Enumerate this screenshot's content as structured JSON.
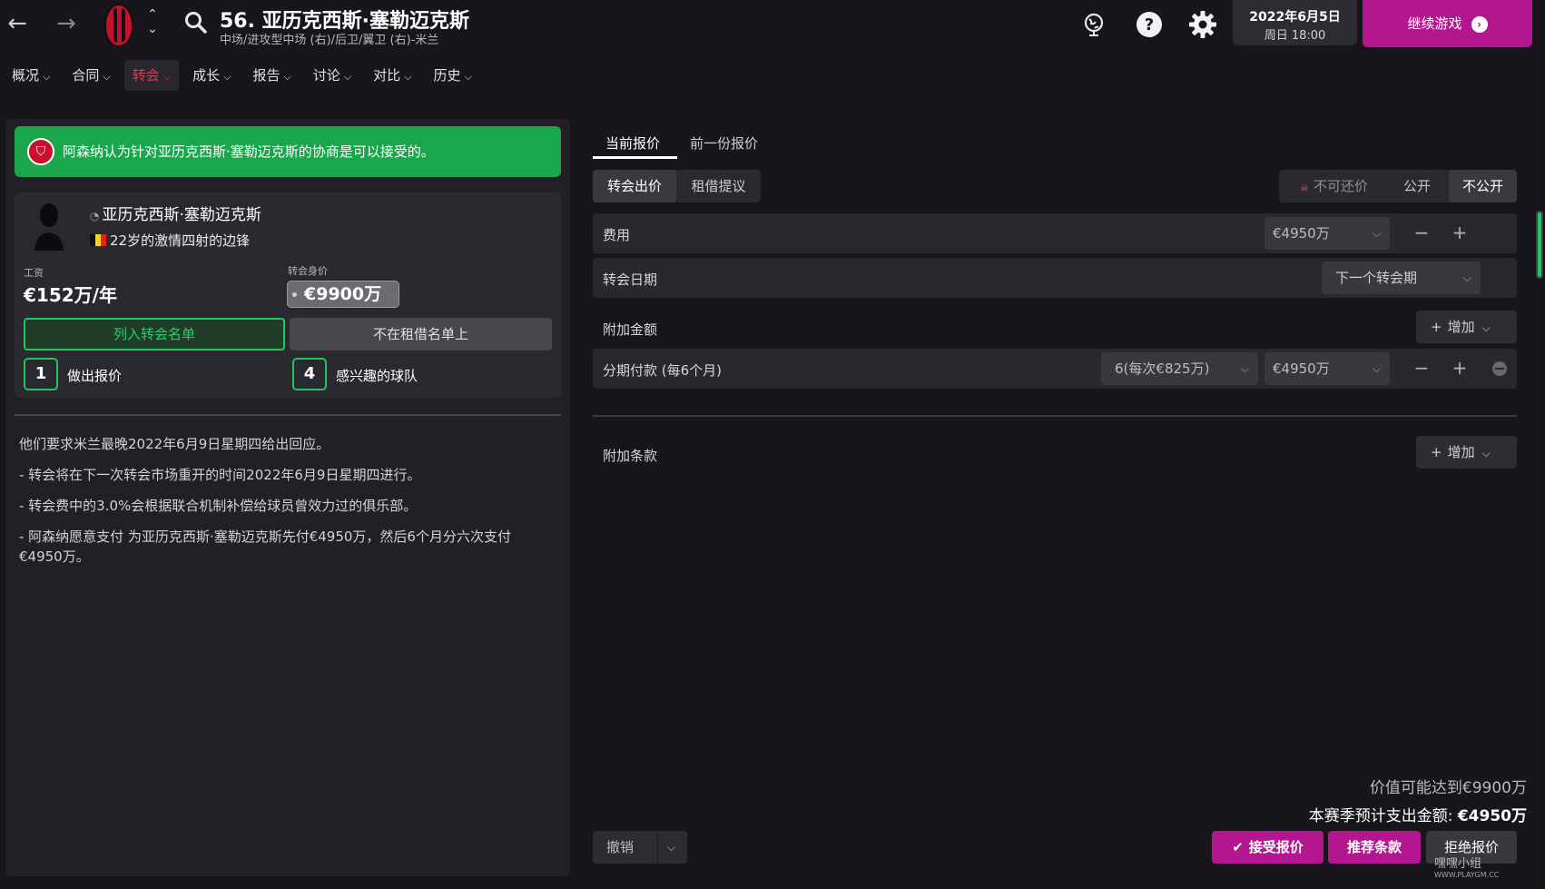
{
  "header": {
    "back_glyph": "←",
    "forward_glyph": "→",
    "player_title": "56. 亚历克西斯·塞勒迈克斯",
    "player_subtitle": "中场/进攻型中场 (右)/后卫/翼卫 (右)-米兰",
    "date_line1": "2022年6月5日",
    "date_line2": "周日 18:00",
    "continue_label": "继续游戏",
    "icons": [
      "back-arrow-icon",
      "forward-arrow-icon",
      "club-badge-icon",
      "up-down-icon",
      "search-icon",
      "world-icon",
      "help-icon",
      "gear-icon"
    ]
  },
  "menu": {
    "items": [
      {
        "label": "概况"
      },
      {
        "label": "合同"
      },
      {
        "label": "转会"
      },
      {
        "label": "成长"
      },
      {
        "label": "报告"
      },
      {
        "label": "讨论"
      },
      {
        "label": "对比"
      },
      {
        "label": "历史"
      }
    ],
    "active_index": 2
  },
  "left": {
    "banner_text": "阿森纳认为针对亚历克西斯·塞勒迈克斯的协商是可以接受的。",
    "player_name": "亚历克西斯·塞勒迈克斯",
    "player_desc": "22岁的激情四射的边锋",
    "wage_label": "工资",
    "wage_value": "€152万/年",
    "value_label": "转会身价",
    "value_amount": "€9900万",
    "transfer_list_button": "列入转会名单",
    "loan_list_button": "不在租借名单上",
    "offers_count": "1",
    "offers_label": "做出报价",
    "interested_count": "4",
    "interested_label": "感兴趣的球队",
    "notes": [
      "他们要求米兰最晚2022年6月9日星期四给出回应。",
      "- 转会将在下一次转会市场重开的时间2022年6月9日星期四进行。",
      "- 转会费中的3.0%会根据联合机制补偿给球员曾效力过的俱乐部。",
      "- 阿森纳愿意支付 为亚历克西斯·塞勒迈克斯先付€4950万，然后6个月分六次支付€4950万。"
    ]
  },
  "right": {
    "tabs": [
      "当前报价",
      "前一份报价"
    ],
    "offer_types": [
      "转会出价",
      "租借提议"
    ],
    "visibility": {
      "no_counter": "不可还价",
      "public": "公开",
      "private": "不公开"
    },
    "fee_label": "费用",
    "fee_value": "€4950万",
    "date_label": "转会日期",
    "date_value": "下一个转会期",
    "extra_amount_label": "附加金额",
    "add_label": "增加",
    "installment_label": "分期付款 (每6个月)",
    "installment_count": "6(每次€825万)",
    "installment_value": "€4950万",
    "extra_clause_label": "附加条款",
    "potential_value": "价值可能达到€9900万",
    "season_spend_label": "本赛季预计支出金额:",
    "season_spend_value": "€4950万",
    "undo_label": "撤销",
    "accept_label": "接受报价",
    "suggest_label": "推荐条款",
    "reject_label": "拒绝报价",
    "watermark": "嘿嘿小组",
    "watermark_url": "WWW.PLAYGM.CC"
  },
  "colors": {
    "accent_magenta": "#b4168f",
    "success_green": "#22c55e",
    "active_tab_red": "#e2394f",
    "background": "#18161c"
  }
}
